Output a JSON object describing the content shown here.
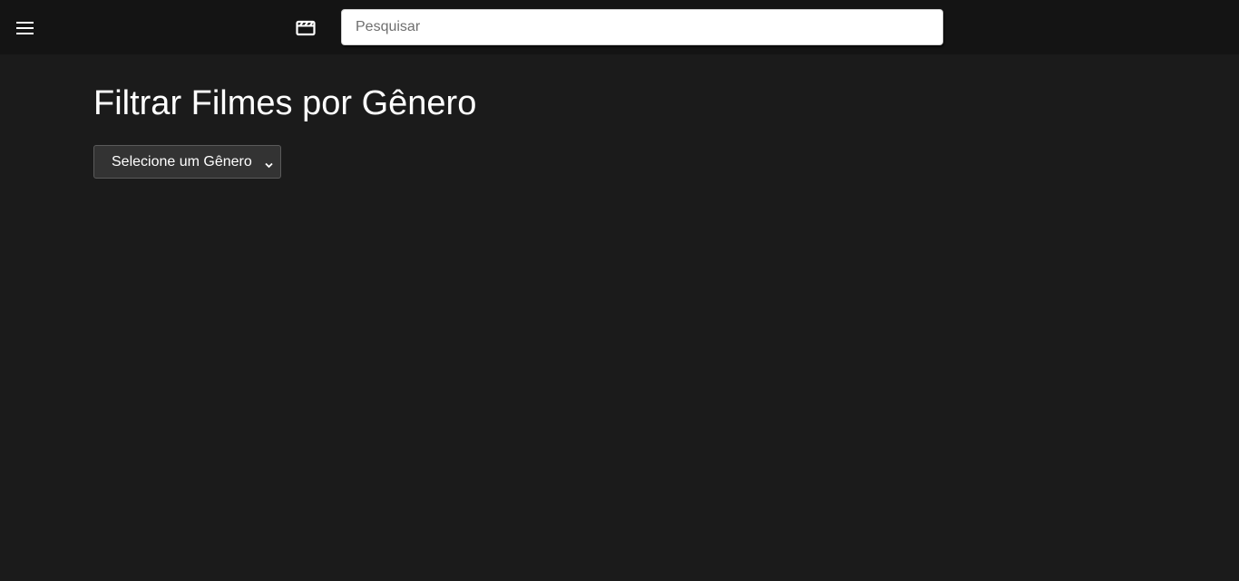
{
  "header": {
    "menu_icon": "hamburger-menu-icon",
    "logo_icon": "clapperboard-icon",
    "search": {
      "placeholder": "Pesquisar",
      "value": ""
    }
  },
  "main": {
    "title": "Filtrar Filmes por Gênero",
    "genre_select": {
      "selected": "Selecione um Gênero",
      "icon": "chevron-down-icon"
    }
  },
  "colors": {
    "background": "#1b1b1b",
    "header_background": "#141414",
    "select_background": "#333333",
    "text": "#ffffff"
  }
}
